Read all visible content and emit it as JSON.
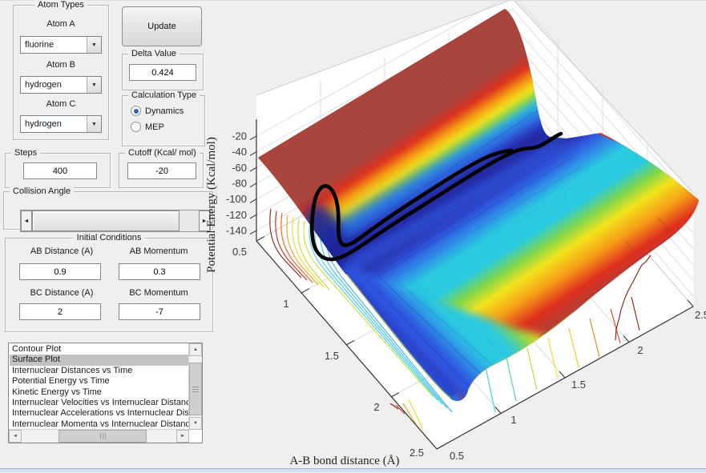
{
  "icons": {
    "dropdown": "▼",
    "slider_left": "◄",
    "slider_right": "►",
    "scroll_up": "▲",
    "scroll_down": "▼",
    "scroll_left": "◄",
    "scroll_right": "►"
  },
  "atom_types": {
    "title": "Atom Types",
    "a_label": "Atom A",
    "a_value": "fluorine",
    "b_label": "Atom B",
    "b_value": "hydrogen",
    "c_label": "Atom C",
    "c_value": "hydrogen"
  },
  "update_label": "Update",
  "delta": {
    "title": "Delta Value",
    "value": "0.424"
  },
  "calculation": {
    "title": "Calculation Type",
    "dynamics": "Dynamics",
    "mep": "MEP",
    "selected": "Dynamics"
  },
  "steps": {
    "title": "Steps",
    "value": "400"
  },
  "cutoff": {
    "title": "Cutoff (Kcal/ mol)",
    "value": "-20"
  },
  "collision": {
    "title": "Collision Angle"
  },
  "initial": {
    "title": "Initial Conditions",
    "ab_dist_label": "AB Distance (A)",
    "ab_dist": "0.9",
    "ab_mom_label": "AB Momentum",
    "ab_mom": "0.3",
    "bc_dist_label": "BC Distance (A)",
    "bc_dist": "2",
    "bc_mom_label": "BC Momentum",
    "bc_mom": "-7"
  },
  "plot_list": {
    "selected": "Surface Plot",
    "items": [
      "Contour Plot",
      "Surface Plot",
      "Internuclear Distances vs Time",
      "Potential Energy vs Time",
      "Kinetic Energy vs Time",
      "Internuclear Velocities vs Internuclear Distance",
      "Internuclear Accelerations vs Internuclear Distance",
      "Internuclear Momenta vs Internuclear Distance"
    ]
  },
  "plot": {
    "type": "3d-surface (potential energy surface with trajectory)",
    "xlabel": "A-B bond distance (Å)",
    "zlabel": "Potential Energy (Kcal/mol)",
    "x_ticks": [
      "0.5",
      "1",
      "1.5",
      "2",
      "2.5"
    ],
    "y_ticks": [
      "0.5",
      "1",
      "1.5",
      "2",
      "2.5"
    ],
    "z_ticks": [
      "-20",
      "-40",
      "-60",
      "-80",
      "-100",
      "-120",
      "-140"
    ],
    "colors": {
      "plateau": "#a8453d",
      "valley": "#2a2ea6",
      "trajectory": "#000000",
      "background": "#efefef",
      "walls": "#ffffff"
    }
  }
}
